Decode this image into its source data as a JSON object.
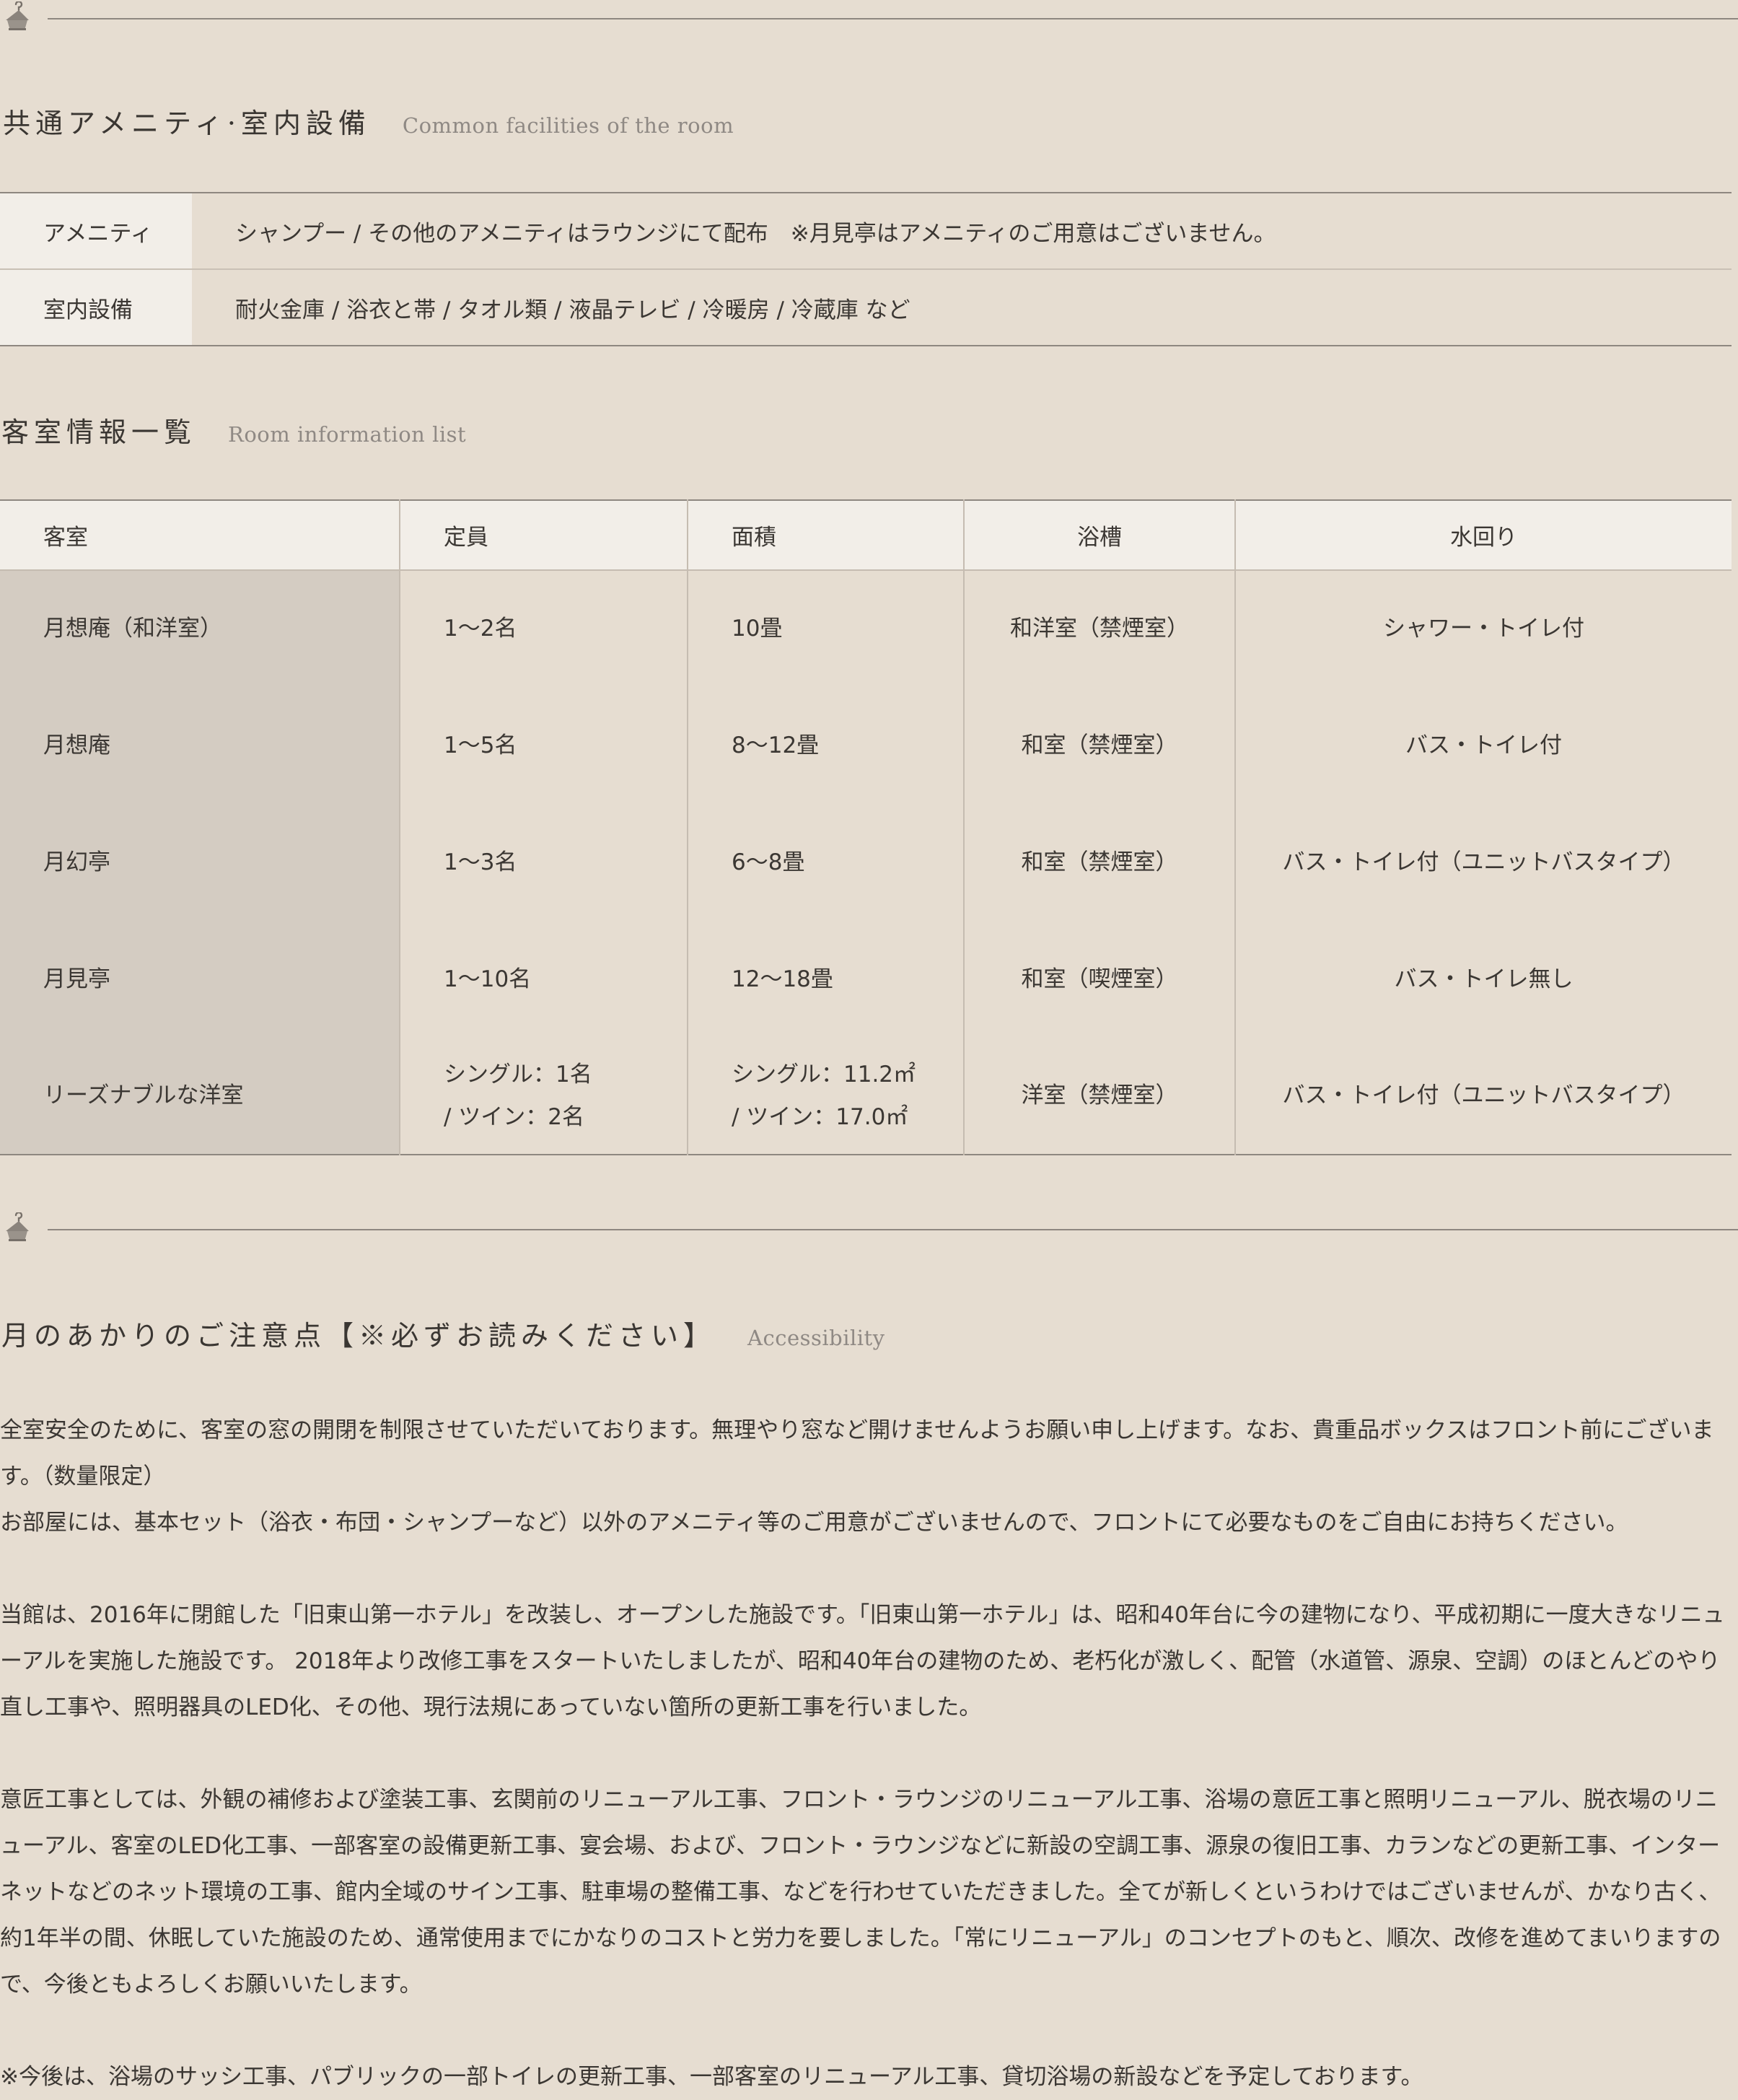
{
  "section1": {
    "title_jp": "共通アメニティ·室内設備",
    "title_en": "Common facilities of the room"
  },
  "amenities": [
    {
      "label": "アメニティ",
      "value": "シャンプー / その他のアメニティはラウンジにて配布　※月見亭はアメニティのご用意はございません。"
    },
    {
      "label": "室内設備",
      "value": "耐火金庫 / 浴衣と帯 / タオル類 / 液晶テレビ / 冷暖房 / 冷蔵庫 など"
    }
  ],
  "section2": {
    "title_jp": "客室情報一覧",
    "title_en": "Room information list"
  },
  "room_table": {
    "headers": [
      "客室",
      "定員",
      "面積",
      "浴槽",
      "水回り"
    ],
    "rows": [
      {
        "room": "月想庵（和洋室）",
        "capacity": "1〜2名",
        "capacity2": "",
        "area": "10畳",
        "area2": "",
        "bath": "和洋室（禁煙室）",
        "water": "シャワー・トイレ付"
      },
      {
        "room": "月想庵",
        "capacity": "1〜5名",
        "capacity2": "",
        "area": "8〜12畳",
        "area2": "",
        "bath": "和室（禁煙室）",
        "water": "バス・トイレ付"
      },
      {
        "room": "月幻亭",
        "capacity": "1〜3名",
        "capacity2": "",
        "area": "6〜8畳",
        "area2": "",
        "bath": "和室（禁煙室）",
        "water": "バス・トイレ付（ユニットバスタイプ）"
      },
      {
        "room": "月見亭",
        "capacity": "1〜10名",
        "capacity2": "",
        "area": "12〜18畳",
        "area2": "",
        "bath": "和室（喫煙室）",
        "water": "バス・トイレ無し"
      },
      {
        "room": "リーズナブルな洋室",
        "capacity": "シングル：1名",
        "capacity2": "/ ツイン：2名",
        "area": "シングル：11.2㎡",
        "area2": "/ ツイン：17.0㎡",
        "bath": "洋室（禁煙室）",
        "water": "バス・トイレ付（ユニットバスタイプ）"
      }
    ]
  },
  "section3": {
    "title_jp": "月のあかりのご注意点【※必ずお読みください】",
    "title_en": "Accessibility"
  },
  "notes": {
    "p1": "全室安全のために、客室の窓の開閉を制限させていただいております。無理やり窓など開けませんようお願い申し上げます。なお、貴重品ボックスはフロント前にございます。（数量限定）",
    "p2": "お部屋には、基本セット（浴衣・布団・シャンプーなど）以外のアメニティ等のご用意がございませんので、フロントにて必要なものをご自由にお持ちください。",
    "p3": "当館は、2016年に閉館した「旧東山第一ホテル」を改装し、オープンした施設です。「旧東山第一ホテル」は、昭和40年台に今の建物になり、平成初期に一度大きなリニューアルを実施した施設です。 2018年より改修工事をスタートいたしましたが、昭和40年台の建物のため、老朽化が激しく、配管（水道管、源泉、空調）のほとんどのやり直し工事や、照明器具のLED化、その他、現行法規にあっていない箇所の更新工事を行いました。",
    "p4": "意匠工事としては、外観の補修および塗装工事、玄関前のリニューアル工事、フロント・ラウンジのリニューアル工事、浴場の意匠工事と照明リニューアル、脱衣場のリニューアル、客室のLED化工事、一部客室の設備更新工事、宴会場、および、フロント・ラウンジなどに新設の空調工事、源泉の復旧工事、カランなどの更新工事、インターネットなどのネット環境の工事、館内全域のサイン工事、駐車場の整備工事、などを行わせていただきました。全てが新しくというわけではございませんが、かなり古く、約1年半の間、休眠していた施設のため、通常使用までにかなりのコストと労力を要しました。「常にリニューアル」のコンセプトのもと、順次、改修を進めてまいりますので、今後ともよろしくお願いいたします。",
    "p5": "※今後は、浴場のサッシ工事、パブリックの一部トイレの更新工事、一部客室のリニューアル工事、貸切浴場の新設などを予定しております。"
  },
  "icons": {
    "divider": "hanger-icon"
  },
  "colors": {
    "background": "#e6ddd1",
    "label_cell": "#f2eee8",
    "room_name_cell": "#d4ccc2",
    "rule": "#8e8780",
    "text": "#3b3733",
    "subtitle": "#8f8984"
  }
}
